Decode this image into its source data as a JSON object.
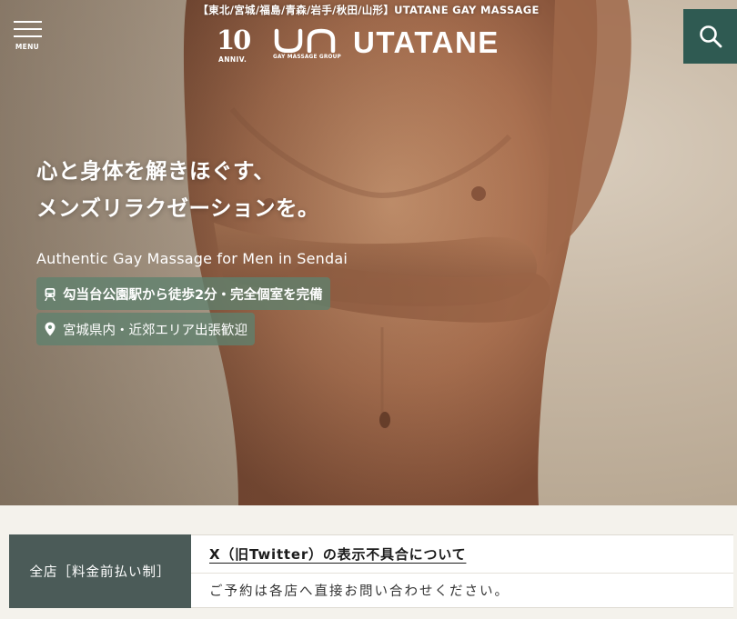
{
  "header": {
    "region_line": "【東北/宮城/福島/青森/岩手/秋田/山形】UTATANE GAY MASSAGE",
    "menu_label": "MENU",
    "search_icon": "search-icon",
    "logo": {
      "anniv_number": "10",
      "anniv_label": "ANNIV.",
      "mark_text": "un",
      "mark_subtitle": "GAY MASSAGE GROUP",
      "brand_name": "UTATANE"
    }
  },
  "hero": {
    "headline_line1": "心と身体を解きほぐす、",
    "headline_line2": "メンズリラクゼーションを。",
    "tagline": "Authentic Gay Massage for Men in Sendai",
    "chips": [
      {
        "icon": "train-icon",
        "text": "勾当台公園駅から徒歩2分・完全個室を完備"
      },
      {
        "icon": "map-pin-icon",
        "text": "宮城県内・近郊エリア出張歓迎"
      }
    ]
  },
  "notice": {
    "label": "全店［料金前払い制］",
    "title": "X（旧Twitter）の表示不具合について",
    "text": "ご予約は各店へ直接お問い合わせください。"
  },
  "colors": {
    "search_bg": "#2f5a52",
    "chip_bg": "#5f826e",
    "notice_label_bg": "#4b5b58",
    "page_bg": "#f4f2ec"
  }
}
